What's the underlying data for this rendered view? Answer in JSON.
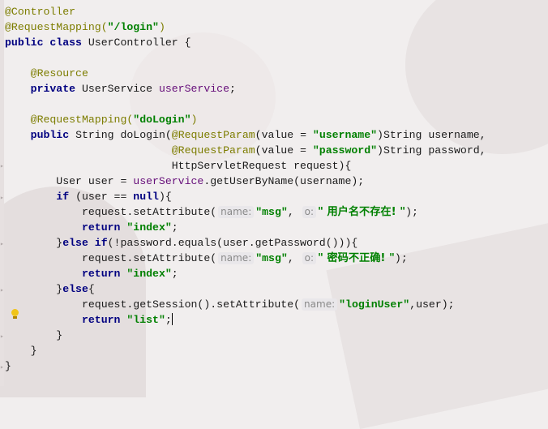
{
  "editor": {
    "lines": [
      [
        {
          "c": "ann",
          "t": "@Controller"
        }
      ],
      [
        {
          "c": "ann",
          "t": "@RequestMapping("
        },
        {
          "c": "str",
          "t": "\"/login\""
        },
        {
          "c": "ann",
          "t": ")"
        }
      ],
      [
        {
          "c": "kw",
          "t": "public class "
        },
        {
          "c": "cls",
          "t": "UserController {"
        }
      ],
      [],
      [
        {
          "c": "cls",
          "t": "    "
        },
        {
          "c": "ann",
          "t": "@Resource"
        }
      ],
      [
        {
          "c": "cls",
          "t": "    "
        },
        {
          "c": "kw",
          "t": "private "
        },
        {
          "c": "cls",
          "t": "UserService "
        },
        {
          "c": "fld",
          "t": "userService"
        },
        {
          "c": "cls",
          "t": ";"
        }
      ],
      [],
      [
        {
          "c": "cls",
          "t": "    "
        },
        {
          "c": "ann",
          "t": "@RequestMapping("
        },
        {
          "c": "str",
          "t": "\"doLogin\""
        },
        {
          "c": "ann",
          "t": ")"
        }
      ],
      [
        {
          "c": "cls",
          "t": "    "
        },
        {
          "c": "kw",
          "t": "public "
        },
        {
          "c": "cls",
          "t": "String doLogin("
        },
        {
          "c": "ann",
          "t": "@RequestParam"
        },
        {
          "c": "cls",
          "t": "(value = "
        },
        {
          "c": "str",
          "t": "\"username\""
        },
        {
          "c": "cls",
          "t": ")String username,"
        }
      ],
      [
        {
          "c": "cls",
          "t": "                          "
        },
        {
          "c": "ann",
          "t": "@RequestParam"
        },
        {
          "c": "cls",
          "t": "(value = "
        },
        {
          "c": "str",
          "t": "\"password\""
        },
        {
          "c": "cls",
          "t": ")String password,"
        }
      ],
      [
        {
          "c": "cls",
          "t": "                          HttpServletRequest request){"
        }
      ],
      [
        {
          "c": "cls",
          "t": "        User user = "
        },
        {
          "c": "fld",
          "t": "userService"
        },
        {
          "c": "cls",
          "t": ".getUserByName(username);"
        }
      ],
      [
        {
          "c": "cls",
          "t": "        "
        },
        {
          "c": "kw",
          "t": "if "
        },
        {
          "c": "cls",
          "t": "(user == "
        },
        {
          "c": "kw",
          "t": "null"
        },
        {
          "c": "cls",
          "t": "){"
        }
      ],
      [
        {
          "c": "cls",
          "t": "            request.setAttribute("
        },
        {
          "c": "hint",
          "t": "name:"
        },
        {
          "c": "str",
          "t": "\"msg\""
        },
        {
          "c": "cls",
          "t": ", "
        },
        {
          "c": "hint",
          "t": "o:"
        },
        {
          "c": "str",
          "t": "\" 用户名不存在! \""
        },
        {
          "c": "cls",
          "t": ");"
        }
      ],
      [
        {
          "c": "cls",
          "t": "            "
        },
        {
          "c": "kw",
          "t": "return "
        },
        {
          "c": "str",
          "t": "\"index\""
        },
        {
          "c": "cls",
          "t": ";"
        }
      ],
      [
        {
          "c": "cls",
          "t": "        }"
        },
        {
          "c": "kw",
          "t": "else if"
        },
        {
          "c": "cls",
          "t": "(!password.equals(user.getPassword())){"
        }
      ],
      [
        {
          "c": "cls",
          "t": "            request.setAttribute("
        },
        {
          "c": "hint",
          "t": "name:"
        },
        {
          "c": "str",
          "t": "\"msg\""
        },
        {
          "c": "cls",
          "t": ", "
        },
        {
          "c": "hint",
          "t": "o:"
        },
        {
          "c": "str",
          "t": "\" 密码不正确! \""
        },
        {
          "c": "cls",
          "t": ");"
        }
      ],
      [
        {
          "c": "cls",
          "t": "            "
        },
        {
          "c": "kw",
          "t": "return "
        },
        {
          "c": "str",
          "t": "\"index\""
        },
        {
          "c": "cls",
          "t": ";"
        }
      ],
      [
        {
          "c": "cls",
          "t": "        }"
        },
        {
          "c": "kw",
          "t": "else"
        },
        {
          "c": "cls",
          "t": "{"
        }
      ],
      [
        {
          "c": "cls",
          "t": "            request.getSession().setAttribute("
        },
        {
          "c": "hint",
          "t": "name:"
        },
        {
          "c": "str",
          "t": "\"loginUser\""
        },
        {
          "c": "cls",
          "t": ",user);"
        }
      ],
      [
        {
          "c": "cls",
          "t": "            "
        },
        {
          "c": "kw",
          "t": "return "
        },
        {
          "c": "str",
          "t": "\"list\""
        },
        {
          "c": "cls",
          "t": ";"
        },
        {
          "c": "caret",
          "t": ""
        }
      ],
      [
        {
          "c": "cls",
          "t": "        }"
        }
      ],
      [
        {
          "c": "cls",
          "t": "    }"
        }
      ],
      [
        {
          "c": "cls",
          "t": "}"
        }
      ]
    ],
    "icons": {
      "intention": "lightbulb-icon",
      "fold": "fold-marker-icon"
    },
    "colors": {
      "annotation": "#7d7d00",
      "keyword": "#000080",
      "string": "#008000",
      "field": "#660e7a",
      "background": "#f1eeee"
    }
  }
}
